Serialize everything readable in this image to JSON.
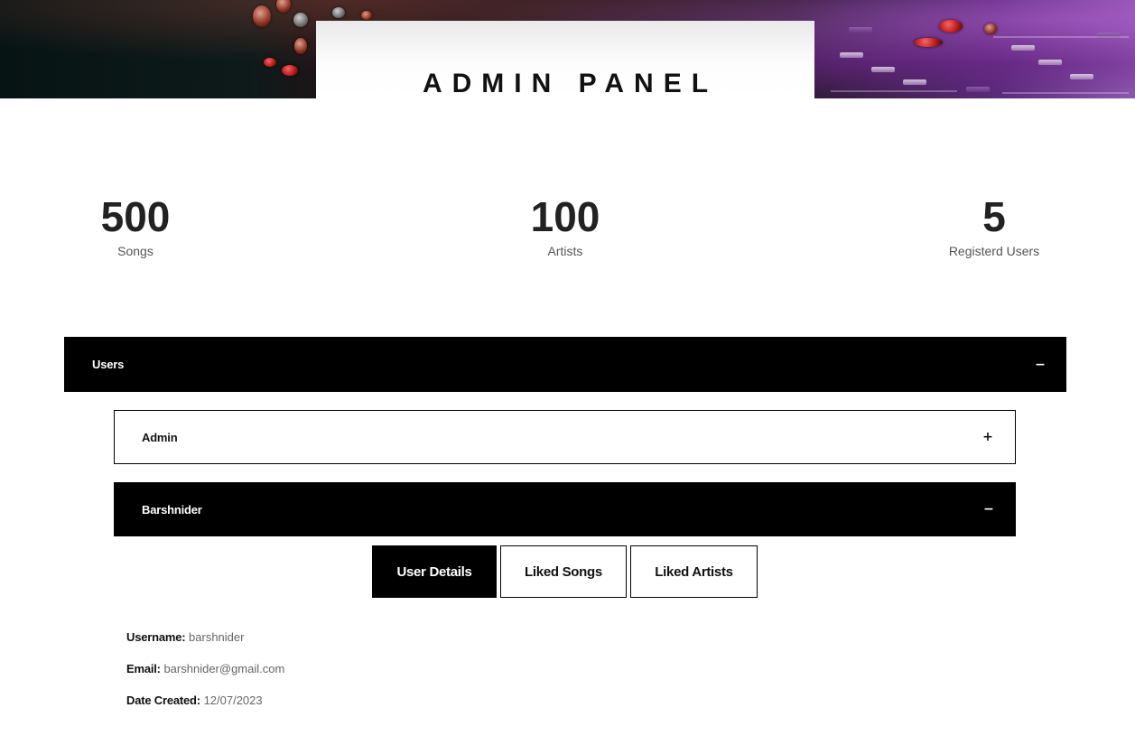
{
  "header": {
    "title": "ADMIN PANEL"
  },
  "stats": [
    {
      "value": "500",
      "label": "Songs"
    },
    {
      "value": "100",
      "label": "Artists"
    },
    {
      "value": "5",
      "label": "Registerd Users"
    }
  ],
  "users_section": {
    "title": "Users",
    "toggle": "−",
    "users": [
      {
        "name": "Admin",
        "toggle": "+",
        "expanded": false
      },
      {
        "name": "Barshnider",
        "toggle": "−",
        "expanded": true
      }
    ]
  },
  "tabs": [
    {
      "label": "User Details",
      "active": true
    },
    {
      "label": "Liked Songs",
      "active": false
    },
    {
      "label": "Liked Artists",
      "active": false
    }
  ],
  "user_details": {
    "username_label": "Username:",
    "username": "barshnider",
    "email_label": "Email:",
    "email": "barshnider@gmail.com",
    "date_label": "Date Created:",
    "date": "12/07/2023"
  },
  "colors": {
    "dark_header": "#000000",
    "stat_text": "#222222",
    "muted_text": "#666666"
  }
}
